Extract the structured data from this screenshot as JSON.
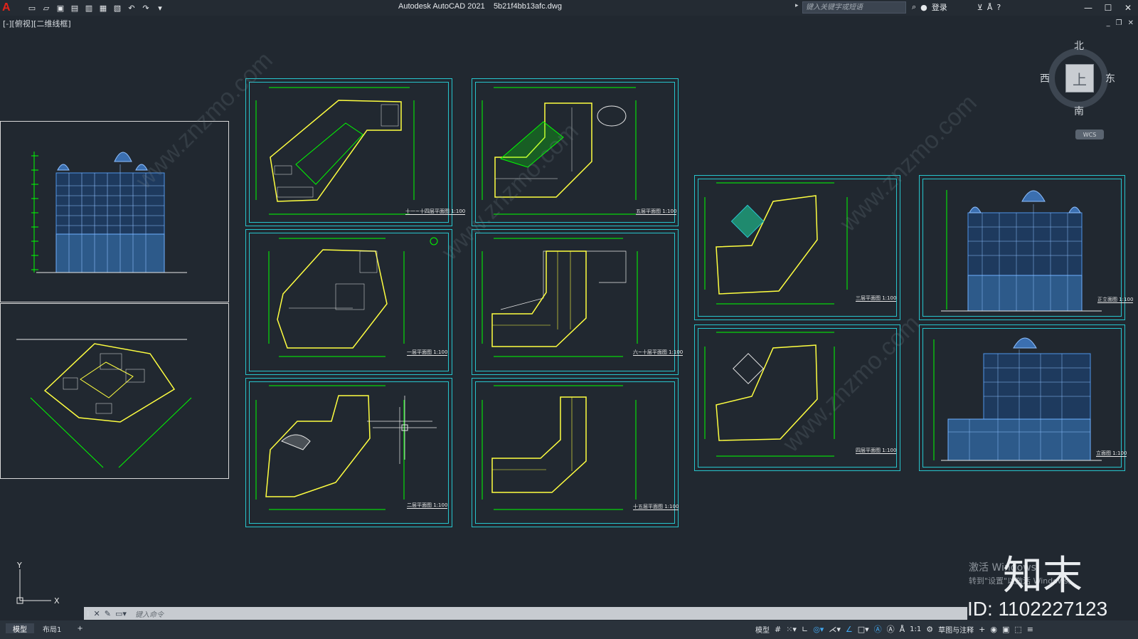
{
  "app": {
    "title": "Autodesk AutoCAD 2021",
    "file": "5b21f4bb13afc.dwg",
    "logo": "A"
  },
  "quick_access": [
    "new-icon",
    "open-icon",
    "save-icon",
    "saveas-icon",
    "plot-preview-icon",
    "publish-icon",
    "print-icon",
    "undo-icon",
    "redo-icon",
    "customize-icon"
  ],
  "search": {
    "placeholder": "键入关键字或短语"
  },
  "login": {
    "label": "登录"
  },
  "viewport_label": "[-][俯视][二维线框]",
  "viewcube": {
    "north": "北",
    "south": "南",
    "east": "东",
    "west": "西",
    "face": "上",
    "wcs": "WCS"
  },
  "sheet_labels": {
    "s1": "十一~十四层平面图 1:100",
    "s2": "五层平面图 1:100",
    "s3": "一层平面图 1:100",
    "s4": "六~十层平面图 1:100",
    "s5": "二层平面图 1:100",
    "s6": "十五层平面图 1:100",
    "s7": "三层平面图 1:100",
    "s8": "四层平面图 1:100",
    "s9": "正立面图 1:100",
    "s10": "立面图 1:100"
  },
  "watermark": {
    "activate_line1": "激活 Windows",
    "activate_line2": "转到\"设置\"以激活 Windows。",
    "logo": "知末",
    "id": "ID: 1102227123",
    "site": "www.znzmo.com"
  },
  "command": {
    "placeholder": "键入命令"
  },
  "layout_tabs": [
    {
      "label": "模型",
      "active": true
    },
    {
      "label": "布局1",
      "active": false
    }
  ],
  "status": {
    "model": "模型",
    "scale": "1:1",
    "workspace": "草图与注释"
  },
  "colors": {
    "sheet_frame": "#27c4cc",
    "plan_lines": "#ffff40",
    "dims": "#00ff00",
    "elevation": "#4f94e8",
    "background": "#212830"
  }
}
